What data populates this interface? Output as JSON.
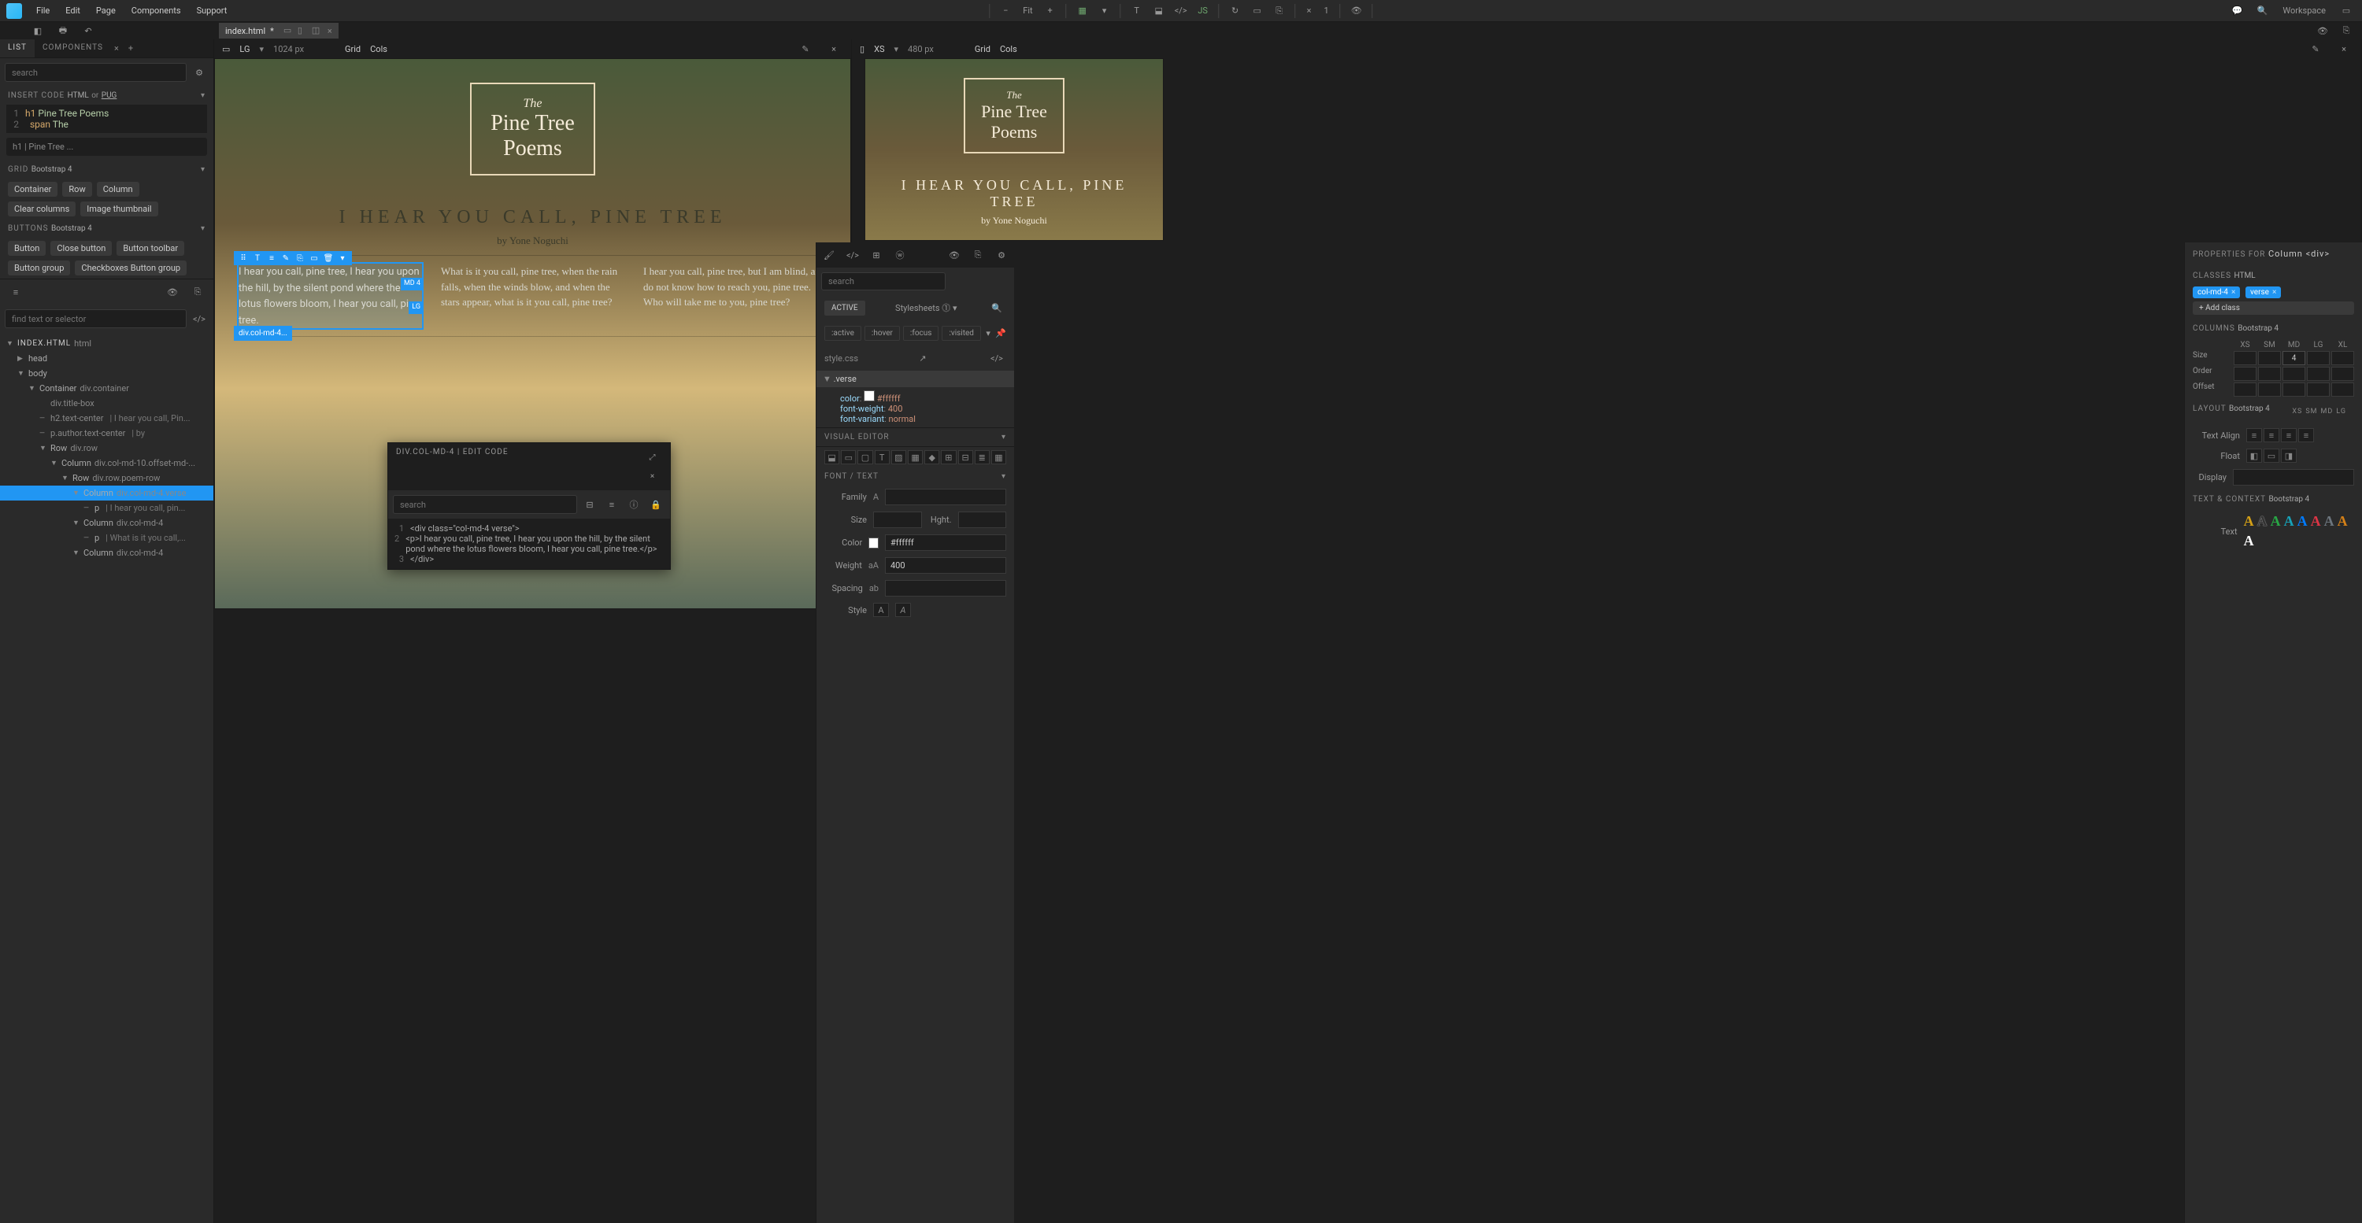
{
  "menubar": {
    "items": [
      "File",
      "Edit",
      "Page",
      "Components",
      "Support"
    ],
    "fit": "Fit",
    "zoom_x": "×",
    "zoom_val": "1",
    "workspace": "Workspace"
  },
  "tab": {
    "name": "index.html",
    "dirty": "*"
  },
  "left": {
    "tabs": {
      "list": "LIST",
      "components": "COMPONENTS"
    },
    "search_placeholder": "search",
    "insert_code": {
      "label": "INSERT CODE",
      "html": "HTML",
      "or": "or",
      "pug": "PUG"
    },
    "code": {
      "line1_tag": "h1",
      "line1_rest": " Pine Tree Poems",
      "line2_tag": "span",
      "line2_rest": " The"
    },
    "field_h1": "h1 | Pine Tree ...",
    "grid": {
      "label": "GRID",
      "sub": "Bootstrap 4",
      "chips": [
        "Container",
        "Row",
        "Column",
        "Clear columns",
        "Image thumbnail"
      ]
    },
    "buttons": {
      "label": "BUTTONS",
      "sub": "Bootstrap 4",
      "chips": [
        "Button",
        "Close button",
        "Button toolbar",
        "Button group",
        "Checkboxes Button group"
      ]
    },
    "find_placeholder": "find text or selector",
    "tree": {
      "root": "INDEX.HTML",
      "root_sub": "html",
      "items": [
        {
          "depth": 1,
          "caret": "▶",
          "tag": "head"
        },
        {
          "depth": 1,
          "caret": "▼",
          "tag": "body"
        },
        {
          "depth": 2,
          "caret": "▼",
          "tag": "Container",
          "cls": "div.container"
        },
        {
          "depth": 3,
          "caret": "",
          "tag": "",
          "cls": "div.title-box"
        },
        {
          "depth": 3,
          "caret": "—",
          "tag": "",
          "cls": "h2.text-center",
          "desc": "| I hear you call, Pin..."
        },
        {
          "depth": 3,
          "caret": "—",
          "tag": "",
          "cls": "p.author.text-center",
          "desc": "| by"
        },
        {
          "depth": 3,
          "caret": "▼",
          "tag": "Row",
          "cls": "div.row"
        },
        {
          "depth": 4,
          "caret": "▼",
          "tag": "Column",
          "cls": "div.col-md-10.offset-md-..."
        },
        {
          "depth": 5,
          "caret": "▼",
          "tag": "Row",
          "cls": "div.row.poem-row"
        },
        {
          "depth": 6,
          "caret": "▼",
          "tag": "Column",
          "cls": "div.col-md-4.verse",
          "active": true
        },
        {
          "depth": 7,
          "caret": "—",
          "tag": "p",
          "desc": "| I hear you call, pin..."
        },
        {
          "depth": 6,
          "caret": "▼",
          "tag": "Column",
          "cls": "div.col-md-4"
        },
        {
          "depth": 7,
          "caret": "—",
          "tag": "p",
          "desc": "| What is it you call,..."
        },
        {
          "depth": 6,
          "caret": "▼",
          "tag": "Column",
          "cls": "div.col-md-4"
        }
      ]
    }
  },
  "canvas": {
    "lg": {
      "label": "LG",
      "size": "1024 px",
      "grid": "Grid",
      "cols": "Cols"
    },
    "xs": {
      "label": "XS",
      "size": "480 px",
      "grid": "Grid",
      "cols": "Cols"
    },
    "poem": {
      "the": "The",
      "title1": "Pine Tree",
      "title2": "Poems",
      "h2": "I HEAR YOU CALL, PINE TREE",
      "author": "by Yone Noguchi",
      "col1": "I hear you call, pine tree, I hear you upon the hill, by the silent pond where the lotus flowers bloom, I hear you call, pine tree.",
      "col2": "What is it you call, pine tree, when the rain falls, when the winds blow, and when the stars appear, what is it you call, pine tree?",
      "col3": "I hear you call, pine tree, but I am blind, and do not know how to reach you, pine tree. Who will take me to you, pine tree?",
      "badge_md": "MD 4",
      "badge_lg": "LG",
      "sel_label": "div.col-md-4..."
    }
  },
  "popup": {
    "title": "DIV.COL-MD-4 | EDIT CODE",
    "search_placeholder": "search",
    "line1": "<div class=\"col-md-4 verse\">",
    "line2": "    <p>I hear you call, pine tree, I hear you upon the hill, by the silent pond where the lotus flowers bloom, I hear you call, pine tree.</p>",
    "line3": "</div>"
  },
  "css": {
    "search_placeholder": "search",
    "active": "ACTIVE",
    "stylesheets": "Stylesheets",
    "states": [
      ":active",
      ":hover",
      ":focus",
      ":visited"
    ],
    "file": "style.css",
    "rule": ".verse",
    "props": [
      {
        "name": "color",
        "val": "#ffffff",
        "swatch": "#ffffff"
      },
      {
        "name": "font-weight",
        "val": "400"
      },
      {
        "name": "font-variant",
        "val": "normal"
      }
    ],
    "visual_editor": "VISUAL EDITOR",
    "font_text": "FONT / TEXT",
    "rows": {
      "family": "Family",
      "size": "Size",
      "hght": "Hght.",
      "color": "Color",
      "color_val": "#ffffff",
      "weight": "Weight",
      "weight_val": "400",
      "spacing": "Spacing",
      "style": "Style"
    }
  },
  "props": {
    "header": "PROPERTIES FOR",
    "header_val": "Column <div>",
    "classes": "CLASSES",
    "classes_sub": "HTML",
    "tags": [
      "col-md-4",
      "verse"
    ],
    "add_class": "+ Add class",
    "columns": "COLUMNS",
    "columns_sub": "Bootstrap 4",
    "bp": [
      "XS",
      "SM",
      "MD",
      "LG",
      "XL"
    ],
    "size": "Size",
    "size_md": "4",
    "order": "Order",
    "offset": "Offset",
    "layout": "LAYOUT",
    "layout_sub": "Bootstrap 4",
    "layout_bp": [
      "XS",
      "SM",
      "MD",
      "LG"
    ],
    "text_align": "Text Align",
    "float": "Float",
    "display": "Display",
    "text_context": "TEXT & CONTEXT",
    "text_context_sub": "Bootstrap 4",
    "text": "Text"
  }
}
